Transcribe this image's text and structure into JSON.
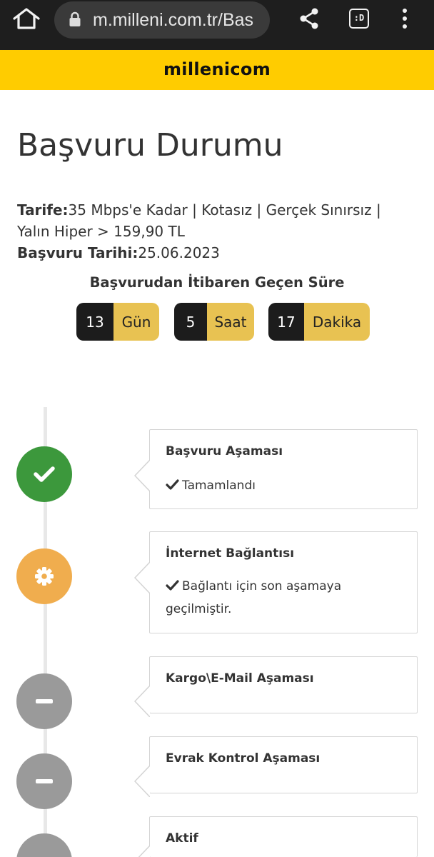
{
  "browser": {
    "url": "m.milleni.com.tr/Bas",
    "extension_label": ":D",
    "icons": [
      "home-icon",
      "lock-icon",
      "share-icon",
      "extension-icon",
      "more-vert-icon"
    ]
  },
  "brand": {
    "logo": "millenicom",
    "color": "#ffcc00"
  },
  "page": {
    "title": "Başvuru Durumu",
    "tariff_label": "Tarife:",
    "tariff_value": "35 Mbps'e Kadar | Kotasız | Gerçek Sınırsız | Yalın Hiper > 159,90 TL",
    "date_label": "Başvuru Tarihi:",
    "date_value": "25.06.2023"
  },
  "elapsed": {
    "title": "Başvurudan İtibaren Geçen Süre",
    "days": {
      "value": "13",
      "unit": "Gün"
    },
    "hours": {
      "value": "5",
      "unit": "Saat"
    },
    "minutes": {
      "value": "17",
      "unit": "Dakika"
    }
  },
  "steps": [
    {
      "title": "Başvuru Aşaması",
      "status": "done",
      "icon": "check-icon",
      "color": "#3c983c",
      "detail": "Tamamlandı"
    },
    {
      "title": "İnternet Bağlantısı",
      "status": "in-progress",
      "icon": "gear-icon",
      "color": "#f0ad4e",
      "detail": "Bağlantı için son aşamaya geçilmiştir."
    },
    {
      "title": "Kargo\\E-Mail Aşaması",
      "status": "pending",
      "icon": "minus-icon",
      "color": "#9a9a9a"
    },
    {
      "title": "Evrak Kontrol Aşaması",
      "status": "pending",
      "icon": "minus-icon",
      "color": "#9a9a9a"
    },
    {
      "title": "Aktif",
      "status": "pending",
      "icon": "minus-icon",
      "color": "#9a9a9a"
    }
  ]
}
